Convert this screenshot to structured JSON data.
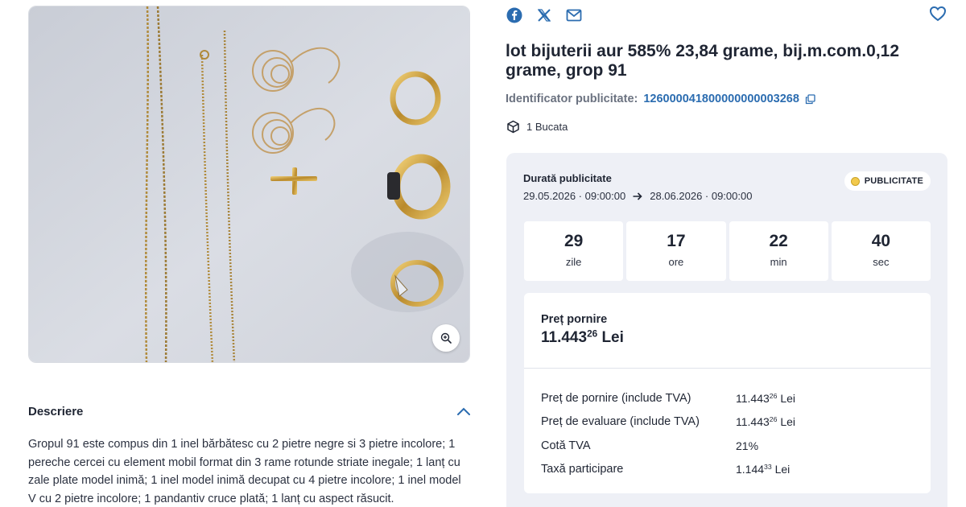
{
  "gallery": {
    "zoom_icon": "zoom-in-icon"
  },
  "share": {
    "icons": [
      "facebook-icon",
      "x-icon",
      "mail-icon"
    ],
    "favorite_icon": "heart-icon"
  },
  "listing": {
    "title": "lot bijuterii aur 585% 23,84 grame, bij.m.com.0,12 grame, grop 91",
    "identifier_label": "Identificator publicitate:",
    "identifier_value": "126000041800000000003268",
    "quantity": "1 Bucata"
  },
  "duration": {
    "label": "Durată publicitate",
    "start": "29.05.2026 · 09:00:00",
    "end": "28.06.2026 · 09:00:00",
    "badge": "PUBLICITATE",
    "badge_color": "#f2c94c"
  },
  "countdown": [
    {
      "value": "29",
      "unit": "zile"
    },
    {
      "value": "17",
      "unit": "ore"
    },
    {
      "value": "22",
      "unit": "min"
    },
    {
      "value": "40",
      "unit": "sec"
    }
  ],
  "price": {
    "label": "Preț pornire",
    "main_int": "11.443",
    "main_dec": "26",
    "currency": "Lei",
    "rows": [
      {
        "label": "Preț de pornire (include TVA)",
        "int": "11.443",
        "dec": "26",
        "unit": "Lei"
      },
      {
        "label": "Preț de evaluare (include TVA)",
        "int": "11.443",
        "dec": "26",
        "unit": "Lei"
      },
      {
        "label": "Cotă TVA",
        "int": "21%",
        "dec": "",
        "unit": ""
      },
      {
        "label": "Taxă participare",
        "int": "1.144",
        "dec": "33",
        "unit": "Lei"
      }
    ]
  },
  "description": {
    "title": "Descriere",
    "text": "Gropul 91 este compus din 1 inel bărbătesc cu 2 pietre negre si 3 pietre incolore; 1 pereche cercei cu element mobil format din 3 rame rotunde striate inegale; 1 lanț cu zale plate model inimă; 1 inel model inimă decupat cu 4 pietre incolore; 1 inel model V cu 2 pietre incolore; 1 pandantiv cruce plată; 1 lanț cu aspect răsucit."
  },
  "colors": {
    "accent": "#2b6cb0",
    "panel": "#eef0f6",
    "text": "#1f2533"
  }
}
